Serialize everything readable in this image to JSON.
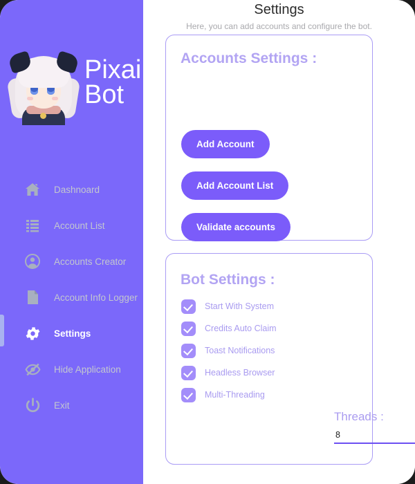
{
  "brand": {
    "name_line1": "Pixai",
    "name_line2": "Bot",
    "avatar_name": "pixai-bot-mascot",
    "sidebar_color": "#7b68fa"
  },
  "sidebar": {
    "items": [
      {
        "label": "Dashnoard",
        "icon": "home-icon",
        "active": false
      },
      {
        "label": "Account List",
        "icon": "list-icon",
        "active": false
      },
      {
        "label": "Accounts Creator",
        "icon": "user-circle-icon",
        "active": false
      },
      {
        "label": "Account Info Logger",
        "icon": "document-icon",
        "active": false
      },
      {
        "label": "Settings",
        "icon": "gear-icon",
        "active": true
      },
      {
        "label": "Hide Application",
        "icon": "eye-slash-icon",
        "active": false
      },
      {
        "label": "Exit",
        "icon": "power-icon",
        "active": false
      }
    ]
  },
  "header": {
    "title": "Settings",
    "subtitle": "Here, you can add accounts and configure the bot."
  },
  "accounts_card": {
    "title": "Accounts Settings :",
    "buttons": [
      {
        "label": "Add Account"
      },
      {
        "label": "Add Account List"
      },
      {
        "label": "Validate accounts"
      }
    ]
  },
  "bot_card": {
    "title": "Bot Settings :",
    "checkboxes": [
      {
        "label": "Start With System",
        "checked": true
      },
      {
        "label": "Credits Auto Claim",
        "checked": true
      },
      {
        "label": "Toast Notifications",
        "checked": true
      },
      {
        "label": "Headless Browser",
        "checked": true
      },
      {
        "label": "Multi-Threading",
        "checked": true
      }
    ],
    "threads_label": "Threads :",
    "threads_value": "8",
    "threads_placeholder": "8"
  },
  "colors": {
    "accent": "#7b5cfa",
    "sidebar": "#7b68fa",
    "card_border": "#a99bf5",
    "muted_purple": "#b2a4f3",
    "checkbox": "#a38dfa",
    "underline": "#6c4ff2"
  }
}
